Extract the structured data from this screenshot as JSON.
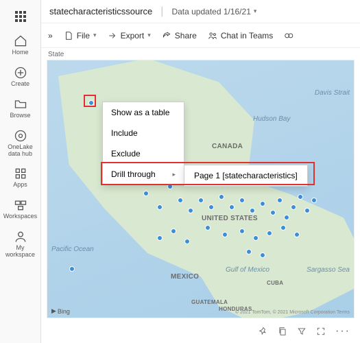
{
  "sidebar": {
    "items": [
      {
        "label": ""
      },
      {
        "label": "Home"
      },
      {
        "label": "Create"
      },
      {
        "label": "Browse"
      },
      {
        "label": "OneLake data hub"
      },
      {
        "label": "Apps"
      },
      {
        "label": "Workspaces"
      },
      {
        "label": "My workspace"
      }
    ]
  },
  "header": {
    "title": "statecharacteristicssource",
    "updated": "Data updated 1/16/21"
  },
  "toolbar": {
    "expand": "»",
    "file": "File",
    "export": "Export",
    "share": "Share",
    "chat": "Chat in Teams"
  },
  "map": {
    "field_label": "State",
    "labels": {
      "canada": "CANADA",
      "us": "UNITED STATES",
      "mexico": "MEXICO",
      "guatemala": "GUATEMALA",
      "honduras": "HONDURAS",
      "cuba": "CUBA",
      "pacific": "Pacific Ocean",
      "hudson": "Hudson Bay",
      "davis": "Davis Strait",
      "gulf_mex": "Gulf of Mexico",
      "sargasso": "Sargasso Sea"
    },
    "provider": "Bing",
    "copyright": "© 2021 TomTom, © 2021 Microsoft Corporation Terms"
  },
  "context_menu": {
    "show_table": "Show as a table",
    "include": "Include",
    "exclude": "Exclude",
    "drill": "Drill through",
    "drill_target": "Page 1 [statecharacteristics]"
  }
}
